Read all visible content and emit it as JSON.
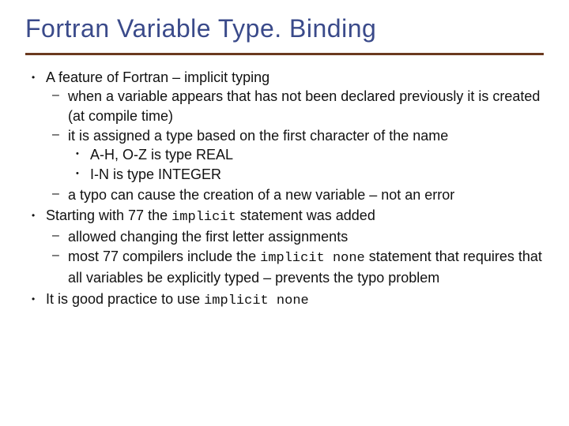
{
  "title": "Fortran Variable Type. Binding",
  "b1": {
    "text": "A feature of Fortran – implicit typing",
    "sub": {
      "s1": "when a variable appears that has not been declared previously it is created (at compile time)",
      "s2": "it is assigned a type based on the first character of the name",
      "s2sub": {
        "a": "A-H, O-Z is type REAL",
        "b": "I-N is type INTEGER"
      },
      "s3": "a typo can cause the creation of a new variable – not an error"
    }
  },
  "b2": {
    "pre": "Starting with 77 the ",
    "code": "implicit",
    "post": " statement was added",
    "sub": {
      "s1": "allowed changing the first letter assignments",
      "s2pre": "most 77 compilers include the ",
      "s2code": "implicit none",
      "s2post": " statement that requires that all variables be explicitly typed – prevents the typo problem"
    }
  },
  "b3": {
    "pre": "It is good practice to use ",
    "code": "implicit none"
  }
}
